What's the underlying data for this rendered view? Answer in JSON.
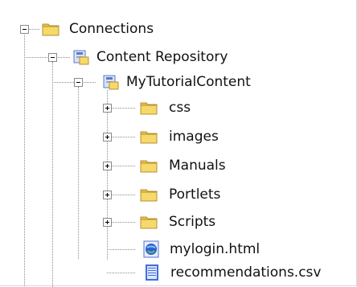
{
  "tree": {
    "root": {
      "label": "Connections",
      "expanded": true,
      "icon": "folder-icon",
      "children": [
        {
          "label": "Content Repository",
          "expanded": true,
          "icon": "repository-icon",
          "children": [
            {
              "label": "MyTutorialContent",
              "expanded": true,
              "icon": "repository-icon",
              "children": [
                {
                  "label": "css",
                  "icon": "folder-icon",
                  "expanded": false
                },
                {
                  "label": "images",
                  "icon": "folder-icon",
                  "expanded": false
                },
                {
                  "label": "Manuals",
                  "icon": "folder-icon",
                  "expanded": false
                },
                {
                  "label": "Portlets",
                  "icon": "folder-icon",
                  "expanded": false
                },
                {
                  "label": "Scripts",
                  "icon": "folder-icon",
                  "expanded": false
                },
                {
                  "label": "mylogin.html",
                  "icon": "html-file-icon"
                },
                {
                  "label": "recommendations.csv",
                  "icon": "csv-file-icon"
                }
              ]
            }
          ]
        }
      ]
    }
  },
  "colors": {
    "folder_fill": "#f5d96b",
    "folder_tab": "#e7c14e",
    "folder_stroke": "#b9902e",
    "file_blue": "#3f6fd8",
    "repo_blue": "#5a7cc7",
    "repo_bg": "#d9e2f5"
  }
}
